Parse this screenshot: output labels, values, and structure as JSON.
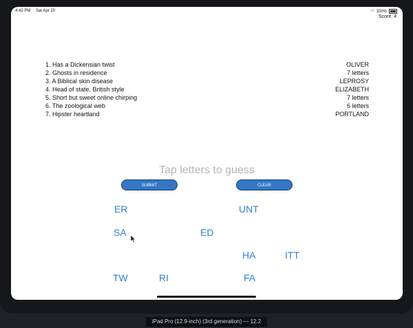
{
  "status_bar": {
    "time": "4:42 PM",
    "date": "Sat Apr 20",
    "battery": "100%"
  },
  "score": "Score: 4",
  "clues": [
    {
      "clue": "1. Has a Dickensian twist",
      "answer": "OLIVER"
    },
    {
      "clue": "2. Ghosts in residence",
      "answer": "7 letters"
    },
    {
      "clue": "3. A Biblical skin disease",
      "answer": "LEPROSY"
    },
    {
      "clue": "4. Head of state, British style",
      "answer": "ELIZABETH"
    },
    {
      "clue": "5. Short but sweet online chirping",
      "answer": "7 letters"
    },
    {
      "clue": "6. The zoological web",
      "answer": "6 letters"
    },
    {
      "clue": "7. Hipster heartland",
      "answer": "PORTLAND"
    }
  ],
  "guess_placeholder": "Tap letters to guess",
  "buttons": {
    "submit": "SUBMIT",
    "clear": "CLEAR"
  },
  "tiles": [
    "ER",
    "UNT",
    "SA",
    "ED",
    "HA",
    "ITT",
    "TW",
    "RI",
    "FA"
  ],
  "device_label": "iPad Pro (12.9-inch) (3rd generation) — 12.2",
  "colors": {
    "accent": "#3377c4",
    "tile_text": "#2f7fd0",
    "placeholder": "#b5b5b8"
  }
}
